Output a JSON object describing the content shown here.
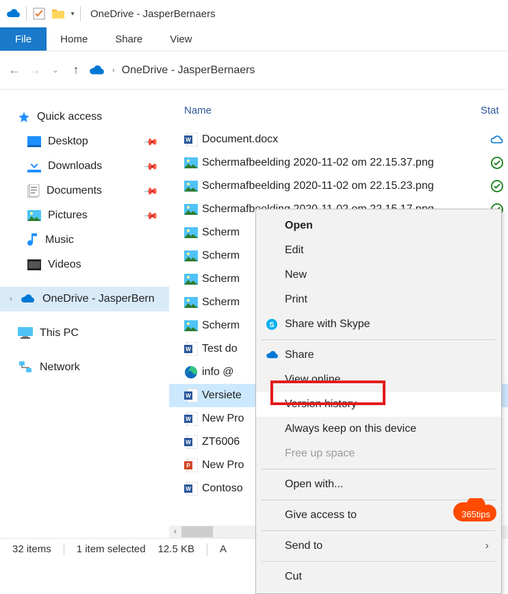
{
  "window": {
    "title": "OneDrive - JasperBernaers"
  },
  "ribbon": {
    "file": "File",
    "home": "Home",
    "share": "Share",
    "view": "View"
  },
  "breadcrumb": {
    "root": "OneDrive - JasperBernaers"
  },
  "sidebar": {
    "quick_access": "Quick access",
    "items": [
      {
        "label": "Desktop",
        "pinned": true
      },
      {
        "label": "Downloads",
        "pinned": true
      },
      {
        "label": "Documents",
        "pinned": true
      },
      {
        "label": "Pictures",
        "pinned": true
      },
      {
        "label": "Music",
        "pinned": false
      },
      {
        "label": "Videos",
        "pinned": false
      }
    ],
    "onedrive": "OneDrive - JasperBern",
    "thispc": "This PC",
    "network": "Network"
  },
  "columns": {
    "name": "Name",
    "status": "Stat"
  },
  "files": [
    {
      "name": "Document.docx",
      "icon": "word",
      "status": "cloud"
    },
    {
      "name": "Schermafbeelding 2020-11-02 om 22.15.37.png",
      "icon": "png",
      "status": "check"
    },
    {
      "name": "Schermafbeelding 2020-11-02 om 22.15.23.png",
      "icon": "png",
      "status": "check"
    },
    {
      "name": "Schermafbeelding 2020-11-02 om 22.15.17.png",
      "icon": "png",
      "status": "check"
    },
    {
      "name": "Scherm",
      "icon": "png"
    },
    {
      "name": "Scherm",
      "icon": "png"
    },
    {
      "name": "Scherm",
      "icon": "png"
    },
    {
      "name": "Scherm",
      "icon": "png"
    },
    {
      "name": "Scherm",
      "icon": "png"
    },
    {
      "name": "Test do",
      "icon": "word"
    },
    {
      "name": "info @ ",
      "icon": "edge"
    },
    {
      "name": "Versiete",
      "icon": "word",
      "selected": true
    },
    {
      "name": "New Pro",
      "icon": "word"
    },
    {
      "name": "ZT6006",
      "icon": "word"
    },
    {
      "name": "New Pro",
      "icon": "ppt"
    },
    {
      "name": "Contoso",
      "icon": "word"
    }
  ],
  "context_menu": [
    {
      "label": "Open",
      "bold": true
    },
    {
      "label": "Edit"
    },
    {
      "label": "New"
    },
    {
      "label": "Print"
    },
    {
      "label": "Share with Skype",
      "icon": "skype"
    },
    {
      "sep": true
    },
    {
      "label": "Share",
      "icon": "onedrive"
    },
    {
      "label": "View online"
    },
    {
      "label": "Version history",
      "highlight": true,
      "hover": true
    },
    {
      "label": "Always keep on this device"
    },
    {
      "label": "Free up space",
      "disabled": true
    },
    {
      "sep": true
    },
    {
      "label": "Open with..."
    },
    {
      "sep": true
    },
    {
      "label": "Give access to",
      "submenu": true
    },
    {
      "sep": true
    },
    {
      "label": "Send to",
      "submenu": true
    },
    {
      "sep": true
    },
    {
      "label": "Cut"
    }
  ],
  "statusbar": {
    "items_count": "32 items",
    "selected": "1 item selected",
    "size": "12.5 KB",
    "avail": "A"
  },
  "badge_text": "365tips"
}
